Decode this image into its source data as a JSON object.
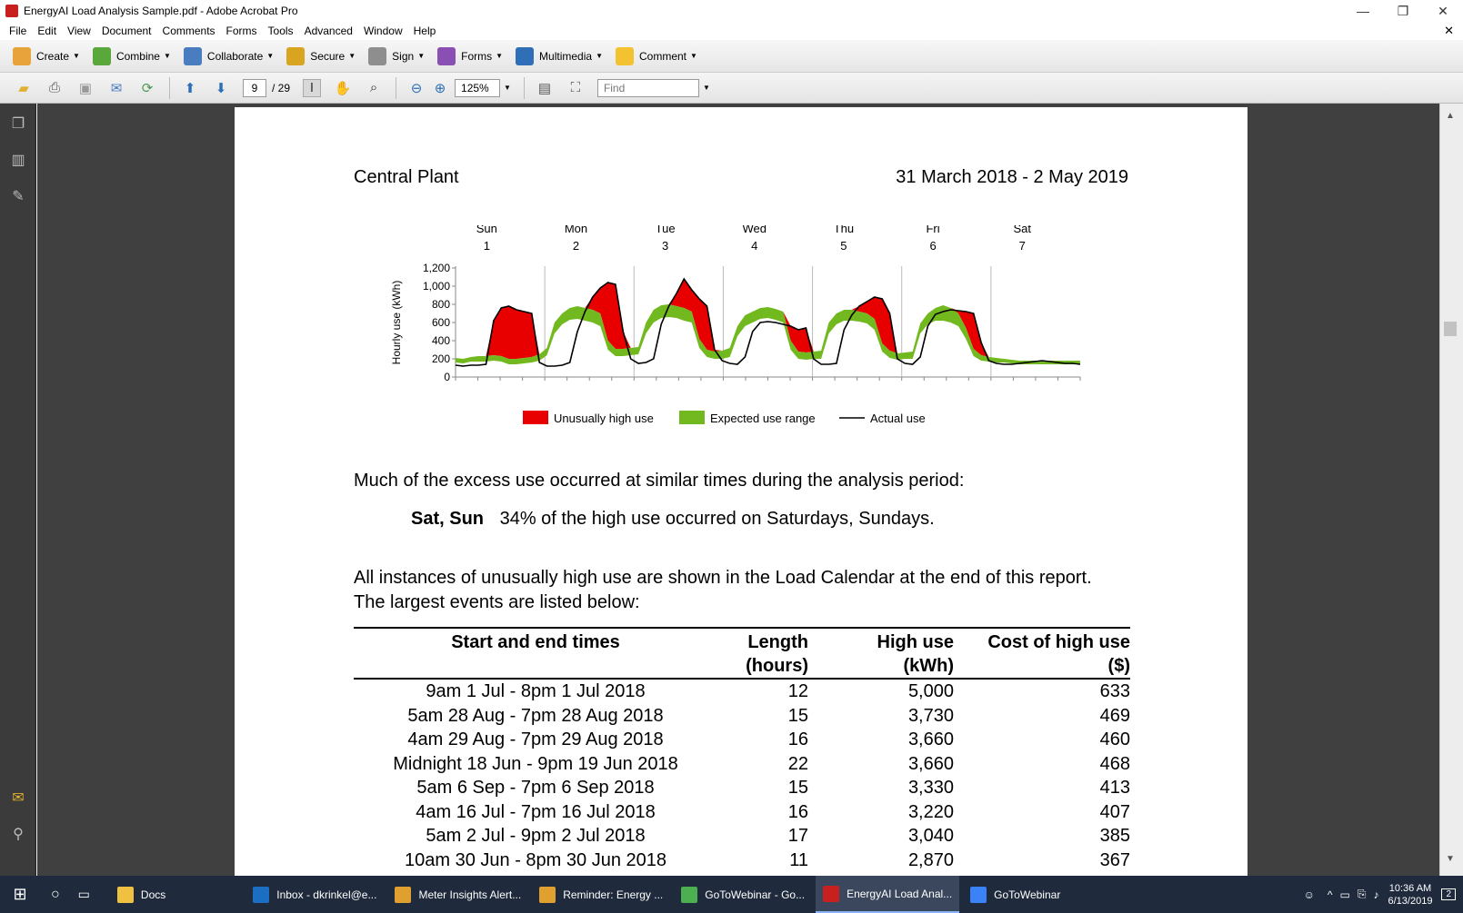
{
  "window": {
    "title": "EnergyAI Load Analysis Sample.pdf - Adobe Acrobat Pro",
    "minimize": "—",
    "restore": "❐",
    "close": "✕"
  },
  "menu": [
    "File",
    "Edit",
    "View",
    "Document",
    "Comments",
    "Forms",
    "Tools",
    "Advanced",
    "Window",
    "Help"
  ],
  "menu_close": "✕",
  "toolbar": [
    {
      "label": "Create",
      "color": "#e8a33a"
    },
    {
      "label": "Combine",
      "color": "#5aa73c"
    },
    {
      "label": "Collaborate",
      "color": "#4a7cc0"
    },
    {
      "label": "Secure",
      "color": "#d9a520"
    },
    {
      "label": "Sign",
      "color": "#8e8e8e"
    },
    {
      "label": "Forms",
      "color": "#8a4fb2"
    },
    {
      "label": "Multimedia",
      "color": "#2f6fb8"
    },
    {
      "label": "Comment",
      "color": "#f2c230"
    }
  ],
  "nav": {
    "page_current": "9",
    "page_total": "/ 29",
    "zoom": "125%",
    "find_placeholder": "Find"
  },
  "document": {
    "site": "Central Plant",
    "period": "31 March 2018 - 2 May 2019",
    "para1": "Much of the excess use occurred at similar times during the analysis period:",
    "highlight_label": "Sat, Sun",
    "highlight_text": "34% of the high use occurred on Saturdays, Sundays.",
    "para2": "All instances of unusually high use are shown in the Load Calendar at the end of this report. The largest events are listed below:",
    "table": {
      "headers": [
        {
          "line1": "Start and end times",
          "line2": ""
        },
        {
          "line1": "Length",
          "line2": "(hours)"
        },
        {
          "line1": "High use",
          "line2": "(kWh)"
        },
        {
          "line1": "Cost of high use",
          "line2": "($)"
        }
      ],
      "rows": [
        [
          "9am 1 Jul - 8pm 1 Jul 2018",
          "12",
          "5,000",
          "633"
        ],
        [
          "5am 28 Aug - 7pm 28 Aug 2018",
          "15",
          "3,730",
          "469"
        ],
        [
          "4am 29 Aug - 7pm 29 Aug 2018",
          "16",
          "3,660",
          "460"
        ],
        [
          "Midnight 18 Jun - 9pm 19 Jun 2018",
          "22",
          "3,660",
          "468"
        ],
        [
          "5am 6 Sep - 7pm 6 Sep 2018",
          "15",
          "3,330",
          "413"
        ],
        [
          "4am 16 Jul - 7pm 16 Jul 2018",
          "16",
          "3,220",
          "407"
        ],
        [
          "5am 2 Jul - 9pm 2 Jul 2018",
          "17",
          "3,040",
          "385"
        ],
        [
          "10am 30 Jun - 8pm 30 Jun 2018",
          "11",
          "2,870",
          "367"
        ]
      ]
    }
  },
  "chart_data": {
    "type": "area",
    "ylabel": "Hourly use (kWh)",
    "ylim": [
      0,
      1200
    ],
    "yticks": [
      "1,200",
      "1,000",
      "800",
      "600",
      "400",
      "200",
      "0"
    ],
    "days": [
      {
        "name": "Sun",
        "num": "1"
      },
      {
        "name": "Mon",
        "num": "2"
      },
      {
        "name": "Tue",
        "num": "3"
      },
      {
        "name": "Wed",
        "num": "4"
      },
      {
        "name": "Thu",
        "num": "5"
      },
      {
        "name": "Fri",
        "num": "6"
      },
      {
        "name": "Sat",
        "num": "7"
      }
    ],
    "legend": [
      "Unusually high use",
      "Expected use range",
      "Actual use"
    ],
    "colors": {
      "high": "#e80000",
      "expected": "#72b920",
      "actual": "#000000"
    },
    "series": [
      {
        "name": "Expected use range (low)",
        "values": [
          160,
          150,
          170,
          170,
          170,
          180,
          170,
          140,
          140,
          150,
          160,
          180,
          240,
          480,
          580,
          630,
          640,
          620,
          600,
          560,
          300,
          230,
          230,
          240,
          250,
          480,
          600,
          650,
          660,
          650,
          620,
          600,
          320,
          220,
          200,
          200,
          220,
          450,
          560,
          600,
          640,
          650,
          630,
          600,
          300,
          200,
          190,
          200,
          200,
          480,
          580,
          620,
          620,
          610,
          590,
          520,
          280,
          210,
          190,
          200,
          200,
          480,
          580,
          620,
          620,
          600,
          560,
          420,
          230,
          180,
          170,
          160,
          160,
          150,
          140,
          140,
          140,
          140,
          140,
          140,
          140,
          140,
          140
        ]
      },
      {
        "name": "Expected use range (high)",
        "values": [
          210,
          200,
          220,
          230,
          230,
          240,
          230,
          200,
          200,
          210,
          220,
          250,
          320,
          600,
          700,
          760,
          780,
          760,
          740,
          700,
          400,
          310,
          310,
          320,
          330,
          600,
          740,
          790,
          800,
          780,
          760,
          720,
          420,
          300,
          280,
          290,
          320,
          560,
          680,
          720,
          760,
          770,
          750,
          720,
          400,
          280,
          270,
          280,
          290,
          600,
          700,
          740,
          740,
          720,
          700,
          640,
          370,
          290,
          260,
          270,
          280,
          590,
          700,
          760,
          790,
          760,
          700,
          540,
          310,
          240,
          220,
          210,
          200,
          190,
          180,
          180,
          180,
          180,
          180,
          180,
          180,
          180,
          180
        ]
      },
      {
        "name": "Actual use",
        "values": [
          130,
          120,
          130,
          130,
          140,
          620,
          760,
          780,
          740,
          720,
          700,
          160,
          120,
          120,
          130,
          160,
          500,
          720,
          880,
          980,
          1040,
          1020,
          500,
          200,
          150,
          160,
          200,
          580,
          780,
          920,
          1080,
          960,
          860,
          780,
          300,
          180,
          150,
          140,
          220,
          500,
          600,
          610,
          600,
          580,
          560,
          520,
          540,
          200,
          140,
          140,
          150,
          520,
          680,
          780,
          830,
          880,
          860,
          700,
          200,
          150,
          140,
          220,
          560,
          690,
          720,
          740,
          730,
          720,
          700,
          380,
          180,
          150,
          140,
          140,
          150,
          160,
          170,
          180,
          170,
          160,
          150,
          150,
          140
        ]
      }
    ]
  },
  "leftpanel_icons": [
    "pages-icon",
    "bookmarks-icon",
    "signatures-icon",
    "comments-icon",
    "attachments-icon"
  ],
  "taskbar": {
    "items": [
      {
        "label": "Docs",
        "color": "#f0c040"
      },
      {
        "label": "Inbox - dkrinkel@e...",
        "color": "#1b6ec2"
      },
      {
        "label": "Meter Insights Alert...",
        "color": "#e0a030"
      },
      {
        "label": "Reminder:  Energy ...",
        "color": "#e0a030"
      },
      {
        "label": "GoToWebinar - Go...",
        "color": "#4caf50"
      },
      {
        "label": "EnergyAI Load Anal...",
        "color": "#c8201e"
      },
      {
        "label": "GoToWebinar",
        "color": "#3b82f6"
      }
    ],
    "time": "10:36 AM",
    "date": "6/13/2019",
    "notif": "2"
  }
}
